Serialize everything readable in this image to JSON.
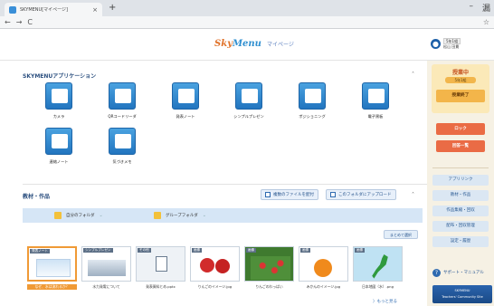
{
  "browser": {
    "tab_title": "SKYMENU[マイページ]",
    "close": "×",
    "new_tab": "+",
    "back": "←",
    "forward": "→",
    "reload": "C",
    "star": "☆",
    "minimize": "–",
    "maximize": "漏"
  },
  "header": {
    "logo_text_a": "Sky",
    "logo_text_b": "Menu",
    "page_name": "マイページ",
    "user_class": "5年1組",
    "user_name": "松山 田貫"
  },
  "apps_section": {
    "title": "SKYMENUアプリケーション",
    "collapse": "˄",
    "apps": [
      {
        "label": "カメラ",
        "icon": "camera-icon"
      },
      {
        "label": "QRコードリーダ",
        "icon": "qr-reader-icon"
      },
      {
        "label": "発表ノート",
        "icon": "presentation-note-icon"
      },
      {
        "label": "シンプルプレゼン",
        "icon": "simple-presen-icon"
      },
      {
        "label": "ポジショニング",
        "icon": "positioning-icon"
      },
      {
        "label": "電子黒板",
        "icon": "electronic-blackboard-icon"
      },
      {
        "label": "連絡ノート",
        "icon": "contact-note-icon"
      },
      {
        "label": "気づきメモ",
        "icon": "awareness-memo-icon"
      }
    ]
  },
  "materials_section": {
    "title": "教材・作品",
    "upload_multi": "複数のファイルを配付",
    "upload_here": "このフォルダにアップロード",
    "collapse": "˄",
    "my_folder": "自分のフォルダ",
    "group_folder": "グループフォルダ",
    "dropdown": "⌄",
    "bulk_select": "まとめて選択",
    "files": [
      {
        "tag": "発表ノート",
        "name": "なぜ、水は流れるか？",
        "selected": true
      },
      {
        "tag": "シンプルプレゼン",
        "name": "水力発電について",
        "selected": false
      },
      {
        "tag": "その他",
        "name": "発表資料とめ.pptx",
        "selected": false
      },
      {
        "tag": "画像",
        "name": "りんごのイメージ.jpg",
        "selected": false
      },
      {
        "tag": "画像",
        "name": "りんごのわっぱい",
        "selected": false
      },
      {
        "tag": "画像",
        "name": "みかんのイメージ.jpg",
        "selected": false
      },
      {
        "tag": "画像",
        "name": "日本地図（水）.png",
        "selected": false
      }
    ],
    "more": "〉もっと見る"
  },
  "right_panel": {
    "status": "授業中",
    "status_class": "5年1組",
    "end_class": "授業終了",
    "lock": "ロック",
    "summary": "回答一覧",
    "links": [
      "アプリリンク",
      "教材・作品",
      "作品集縮・回収",
      "配布・回収管理",
      "設定・履歴"
    ],
    "support": "サポート・マニュアル",
    "support_icon": "?",
    "banner_line1": "SKYMENU",
    "banner_line2": "Teachers' Community Site"
  },
  "colors": {
    "accent_blue": "#2e6ab0",
    "status_orange": "#f3b54a",
    "lock_red": "#ea6b45",
    "selected_border": "#f09a36"
  }
}
